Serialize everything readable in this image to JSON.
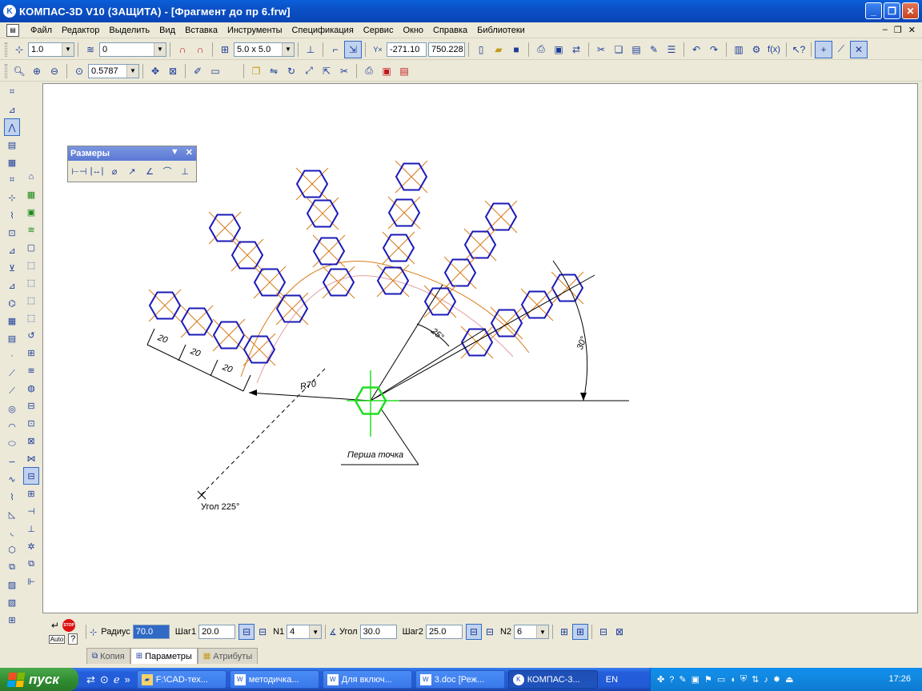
{
  "window": {
    "title": "КОМПАС-3D V10 (ЗАЩИТА) - [Фрагмент до пр 6.frw]",
    "controls": [
      "minimize",
      "maximize",
      "close"
    ]
  },
  "menu": {
    "items": [
      "Файл",
      "Редактор",
      "Выделить",
      "Вид",
      "Вставка",
      "Инструменты",
      "Спецификация",
      "Сервис",
      "Окно",
      "Справка",
      "Библиотеки"
    ]
  },
  "toolbar1": {
    "line_scale": "1.0",
    "layer": "0",
    "grid_step": "5.0 x 5.0",
    "coord_x": "-271.10",
    "coord_y": "750.228"
  },
  "toolbar2": {
    "zoom": "0.5787"
  },
  "float_panel": {
    "title": "Размеры"
  },
  "drawing": {
    "dimension_20_a": "20",
    "dimension_20_b": "20",
    "dimension_20_c": "20",
    "radius_label": "R70",
    "angle_25": "25°",
    "angle_30": "30°",
    "first_point_label": "Перша точка",
    "angle_225_label": "Угол 225°"
  },
  "properties": {
    "radius_label": "Радиус",
    "radius_value": "70.0",
    "step1_label": "Шаг1",
    "step1_value": "20.0",
    "n1_label": "N1",
    "n1_value": "4",
    "angle_label": "Угол",
    "angle_value": "30.0",
    "step2_label": "Шаг2",
    "step2_value": "25.0",
    "n2_label": "N2",
    "n2_value": "6",
    "auto_label": "Auto"
  },
  "tabs": [
    "Копия",
    "Параметры",
    "Атрибуты"
  ],
  "taskbar": {
    "start_label": "пуск",
    "tasks": [
      "F:\\CAD-тех...",
      "методичка...",
      "Для включ...",
      "3.doc [Реж...",
      "КОМПАС-3..."
    ],
    "language": "EN",
    "clock": "17:26"
  },
  "colors": {
    "hex_blue": "#1a1ab8",
    "axis_orange": "#d87a18",
    "center_green": "#22dd22"
  }
}
